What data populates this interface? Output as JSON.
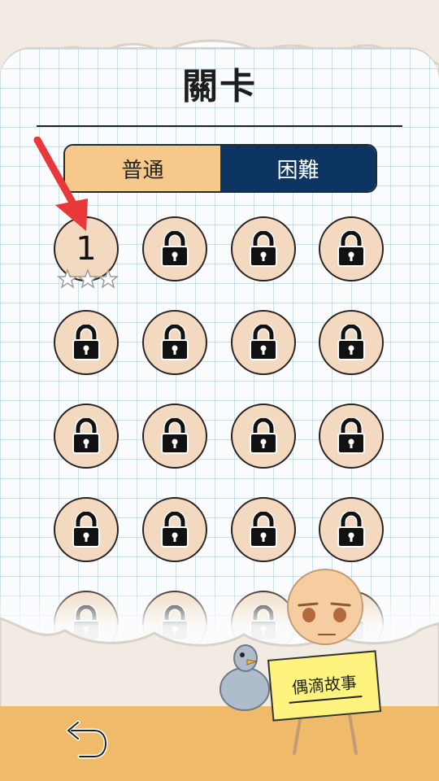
{
  "header": {
    "title": "關卡"
  },
  "tabs": [
    {
      "label": "普通",
      "active": true
    },
    {
      "label": "困難",
      "active": false
    }
  ],
  "levels": {
    "unlocked": {
      "number": "1",
      "stars_earned": 0,
      "stars_total": 3
    },
    "locked_icon": "lock-icon"
  },
  "sign": {
    "text": "偶滴故事"
  },
  "colors": {
    "tab_normal": "#f6c98b",
    "tab_hard": "#0c3561",
    "level_fill": "#f2d9c0",
    "bottom_bar": "#efbb6a",
    "sign": "#fdf37e",
    "arrow": "#e8383a"
  }
}
